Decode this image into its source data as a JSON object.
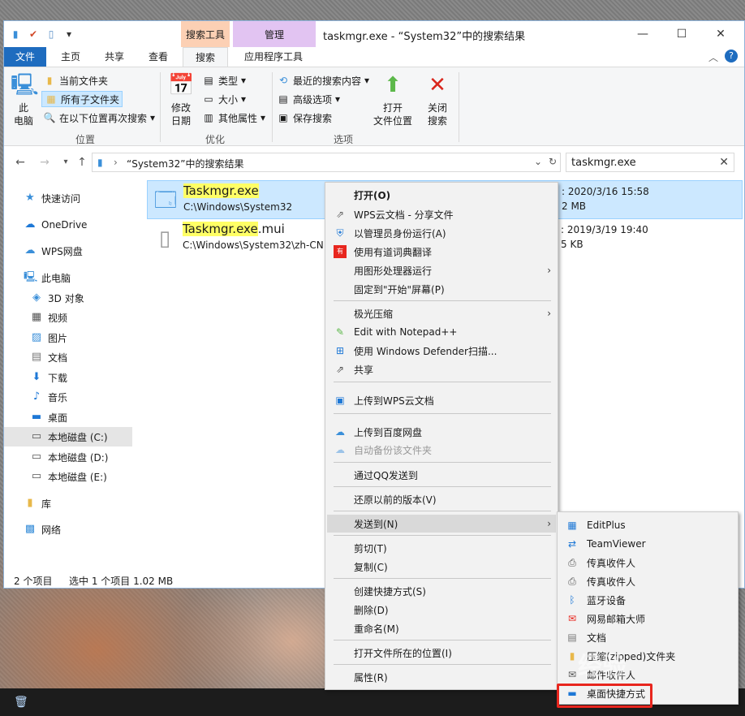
{
  "window": {
    "title": "taskmgr.exe - “System32”中的搜索结果",
    "context_tab_search": "搜索工具",
    "context_tab_manage": "管理",
    "controls": {
      "minimize": "—",
      "maximize": "☐",
      "close": "✕"
    }
  },
  "tabs": {
    "file": "文件",
    "home": "主页",
    "share": "共享",
    "view": "查看",
    "search": "搜索",
    "app_tools": "应用程序工具"
  },
  "ribbon": {
    "location": {
      "this_pc": "此\n电脑",
      "this_pc_l1": "此",
      "this_pc_l2": "电脑",
      "current_folder": "当前文件夹",
      "all_subfolders": "所有子文件夹",
      "search_again_in": "在以下位置再次搜索",
      "group": "位置"
    },
    "refine": {
      "modified_l1": "修改",
      "modified_l2": "日期",
      "kind": "类型",
      "size": "大小",
      "other_props": "其他属性",
      "group": "优化"
    },
    "options": {
      "recent_searches": "最近的搜索内容",
      "advanced": "高级选项",
      "save_search": "保存搜索",
      "open_location_l1": "打开",
      "open_location_l2": "文件位置",
      "close_search_l1": "关闭",
      "close_search_l2": "搜索",
      "group": "选项"
    }
  },
  "address": {
    "path": "“System32”中的搜索结果",
    "search_value": "taskmgr.exe"
  },
  "nav": {
    "quick_access": "快速访问",
    "onedrive": "OneDrive",
    "wps": "WPS网盘",
    "this_pc": "此电脑",
    "objects3d": "3D 对象",
    "videos": "视频",
    "pictures": "图片",
    "documents": "文档",
    "downloads": "下载",
    "music": "音乐",
    "desktop": "桌面",
    "disk_c": "本地磁盘 (C:)",
    "disk_d": "本地磁盘 (D:)",
    "disk_e": "本地磁盘 (E:)",
    "libraries": "库",
    "network": "网络"
  },
  "files": [
    {
      "name_hl": "Taskmgr.exe",
      "name_rest": "",
      "path": "C:\\Windows\\System32",
      "date": ": 2020/3/16 15:58",
      "size": "2 MB"
    },
    {
      "name_hl": "Taskmgr.exe",
      "name_rest": ".mui",
      "path": "C:\\Windows\\System32\\zh-CN",
      "date": ": 2019/3/19 19:40",
      "size": "5 KB"
    }
  ],
  "status": {
    "count": "2 个项目",
    "selected": "选中 1 个项目  1.02 MB"
  },
  "menu": {
    "open": "打开(O)",
    "wps_share": "WPS云文档 - 分享文件",
    "run_admin": "以管理员身份运行(A)",
    "youdao": "使用有道词典翻译",
    "run_gpu": "用图形处理器运行",
    "pin_start": "固定到\"开始\"屏幕(P)",
    "jiguang": "极光压缩",
    "notepadpp": "Edit with Notepad++",
    "defender": "使用 Windows Defender扫描...",
    "share": "共享",
    "upload_wps": "上传到WPS云文档",
    "upload_baidu": "上传到百度网盘",
    "auto_backup": "自动备份该文件夹",
    "send_qq": "通过QQ发送到",
    "restore": "还原以前的版本(V)",
    "send_to": "发送到(N)",
    "cut": "剪切(T)",
    "copy": "复制(C)",
    "create_shortcut": "创建快捷方式(S)",
    "delete": "删除(D)",
    "rename": "重命名(M)",
    "open_location": "打开文件所在的位置(I)",
    "properties": "属性(R)"
  },
  "submenu": {
    "editplus": "EditPlus",
    "teamviewer": "TeamViewer",
    "fax1": "传真收件人",
    "fax2": "传真收件人",
    "bluetooth": "蓝牙设备",
    "mail_master": "网易邮箱大师",
    "documents": "文档",
    "zip": "压缩(zipped)文件夹",
    "mail_recipient": "邮件收件人",
    "desktop_shortcut": "桌面快捷方式"
  },
  "watermark": "经验",
  "colors": {
    "accent": "#1e6cbf",
    "selection": "#cce8ff",
    "highlight": "#ffff66",
    "red_box": "#e8261e"
  }
}
